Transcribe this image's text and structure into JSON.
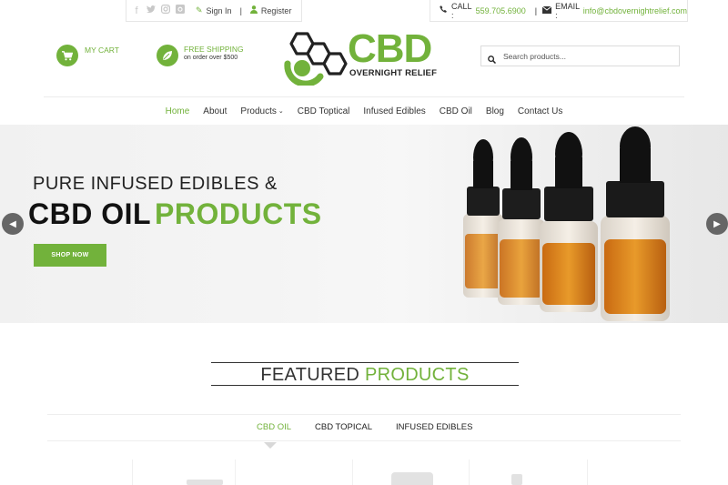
{
  "topbar": {
    "social": [
      {
        "icon": "facebook-icon",
        "glyph": "f"
      },
      {
        "icon": "twitter-icon",
        "glyph": "t"
      },
      {
        "icon": "instagram-icon",
        "glyph": "◎"
      },
      {
        "icon": "instagram-square-icon",
        "glyph": "▣"
      }
    ],
    "signin": "Sign In",
    "separator": "|",
    "register": "Register",
    "call_label": "CALL :",
    "call_value": "559.705.6900",
    "email_label": "EMAIL :",
    "email_value": "info@cbdovernightrelief.com"
  },
  "header": {
    "cart_label": "MY CART",
    "shipping_title": "FREE SHIPPING",
    "shipping_sub": "on order over $500",
    "logo_text": "CBD",
    "logo_sub": "OVERNIGHT RELIEF",
    "search_placeholder": "Search products..."
  },
  "nav": {
    "items": [
      {
        "label": "Home",
        "active": true
      },
      {
        "label": "About"
      },
      {
        "label": "Products",
        "dropdown": true
      },
      {
        "label": "CBD Toptical"
      },
      {
        "label": "Infused Edibles"
      },
      {
        "label": "CBD Oil"
      },
      {
        "label": "Blog"
      },
      {
        "label": "Contact Us"
      }
    ]
  },
  "hero": {
    "line1": "PURE INFUSED EDIBLES &",
    "line2a": "CBD OIL",
    "line2b": "PRODUCTS",
    "cta": "SHOP NOW"
  },
  "featured": {
    "title_a": "FEATURED",
    "title_b": "PRODUCTS",
    "tabs": [
      {
        "label": "CBD OIL",
        "active": true
      },
      {
        "label": "CBD TOPICAL"
      },
      {
        "label": "INFUSED EDIBLES"
      }
    ]
  },
  "colors": {
    "brand_green": "#72b23b",
    "text_dark": "#333333"
  }
}
